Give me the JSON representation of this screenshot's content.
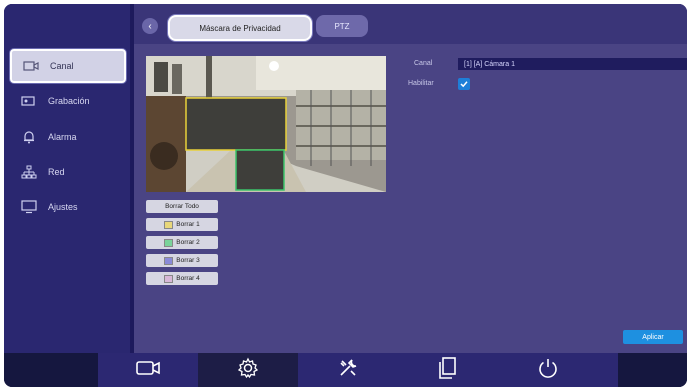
{
  "sidebar": {
    "items": [
      {
        "label": "Canal",
        "icon": "camera-icon",
        "active": true
      },
      {
        "label": "Grabación",
        "icon": "record-icon",
        "active": false
      },
      {
        "label": "Alarma",
        "icon": "alarm-bell-icon",
        "active": false
      },
      {
        "label": "Red",
        "icon": "network-icon",
        "active": false
      },
      {
        "label": "Ajustes",
        "icon": "monitor-icon",
        "active": false
      }
    ]
  },
  "tabs": [
    {
      "label": "Máscara de Privacidad",
      "active": true
    },
    {
      "label": "PTZ",
      "active": false
    }
  ],
  "form": {
    "channel_label": "Canal",
    "channel_value": "[1] [A] Cámara 1",
    "enable_label": "Habilitar",
    "enable_checked": true
  },
  "mask_buttons": [
    {
      "label": "Borrar Todo",
      "swatch": ""
    },
    {
      "label": "Borrar 1",
      "swatch": "#e8d77a"
    },
    {
      "label": "Borrar 2",
      "swatch": "#7ad39a"
    },
    {
      "label": "Borrar 3",
      "swatch": "#8a8ad8"
    },
    {
      "label": "Borrar 4",
      "swatch": "#d8b8d8"
    }
  ],
  "save_label": "Aplicar",
  "colors": {
    "mask1_border": "#e8d13a",
    "mask2_border": "#3ac46a",
    "accent": "#1e90e0",
    "check": "#1e7fd8"
  },
  "taskbar": [
    {
      "name": "camera-icon",
      "active": false
    },
    {
      "name": "settings-gear-icon",
      "active": true
    },
    {
      "name": "tools-icon",
      "active": false
    },
    {
      "name": "files-icon",
      "active": false
    },
    {
      "name": "power-icon",
      "active": false
    }
  ]
}
